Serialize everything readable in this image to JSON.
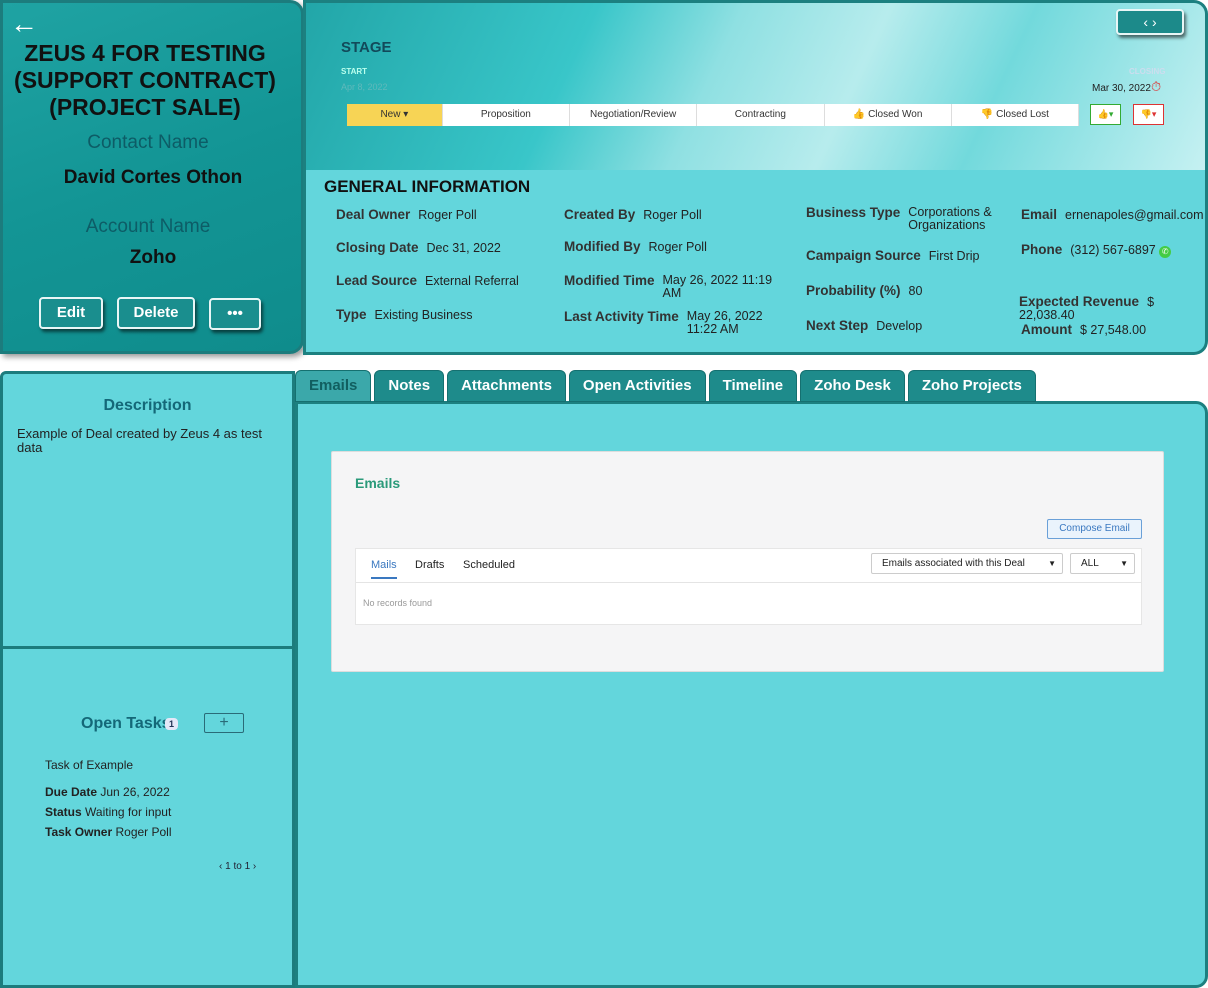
{
  "record": {
    "title": "ZEUS 4 FOR TESTING (SUPPORT CONTRACT) (PROJECT SALE)",
    "contact_label": "Contact Name",
    "contact_value": "David Cortes Othon",
    "account_label": "Account Name",
    "account_value": "Zoho",
    "edit": "Edit",
    "delete": "Delete",
    "more": "•••",
    "back_icon": "arrow-left-icon"
  },
  "stage": {
    "title": "STAGE",
    "start_label": "START",
    "start_date": "Apr 8, 2022",
    "closing_label": "CLOSING",
    "closing_date": "Mar 30, 2022",
    "stages": [
      "New ▾",
      "Proposition",
      "Negotiation/Review",
      "Contracting",
      "👍 Closed Won",
      "👎 Closed Lost"
    ],
    "active_stage": "New",
    "won_btn": "👍▾",
    "lost_btn": "👎▾",
    "nav": "‹ ›"
  },
  "general": {
    "title": "GENERAL INFORMATION",
    "fields": [
      {
        "label": "Deal Owner",
        "value": "Roger Poll"
      },
      {
        "label": "Closing Date",
        "value": "Dec 31, 2022"
      },
      {
        "label": "Lead Source",
        "value": "External Referral"
      },
      {
        "label": "Type",
        "value": "Existing Business"
      },
      {
        "label": "Created By",
        "value": "Roger Poll"
      },
      {
        "label": "Modified By",
        "value": "Roger Poll"
      },
      {
        "label": "Modified Time",
        "value": "May 26, 2022 11:19 AM"
      },
      {
        "label": "Last Activity Time",
        "value": "May 26, 2022 11:22 AM"
      },
      {
        "label": "Business Type",
        "value": "Corporations & Organizations"
      },
      {
        "label": "Campaign Source",
        "value": "First Drip"
      },
      {
        "label": "Probability (%)",
        "value": "80"
      },
      {
        "label": "Next Step",
        "value": "Develop"
      },
      {
        "label": "Email",
        "value": "ernenapoles@gmail.com"
      },
      {
        "label": "Phone",
        "value": "(312) 567-6897"
      },
      {
        "label": "Expected Revenue",
        "value": "$ 22,038.40"
      },
      {
        "label": "Amount",
        "value": "$ 27,548.00"
      }
    ]
  },
  "description": {
    "title": "Description",
    "text": "Example of Deal created by Zeus 4 as test data"
  },
  "tasks": {
    "title": "Open Tasks",
    "count": "1",
    "add": "+",
    "name": "Task of Example",
    "due_label": "Due Date",
    "due": "Jun 26, 2022",
    "status_label": "Status",
    "status": "Waiting for input",
    "owner_label": "Task Owner",
    "owner": "Roger Poll",
    "pager": "1 to 1"
  },
  "tabs": [
    "Emails",
    "Notes",
    "Attachments",
    "Open Activities",
    "Timeline",
    "Zoho Desk",
    "Zoho Projects"
  ],
  "emails": {
    "title": "Emails",
    "compose": "Compose Email",
    "subtabs": [
      "Mails",
      "Drafts",
      "Scheduled"
    ],
    "filter": "Emails associated with this Deal",
    "filter2": "ALL",
    "empty": "No records found"
  },
  "colors": {
    "accent": "#1e8b8b",
    "panel": "#63d6dc",
    "stage_active": "#f7d455"
  }
}
